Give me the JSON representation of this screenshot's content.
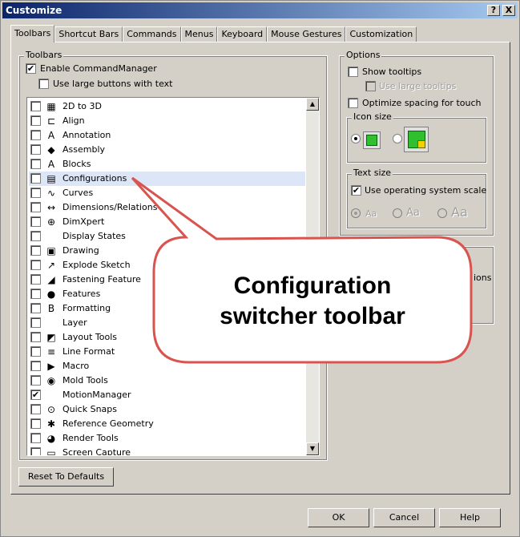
{
  "window": {
    "title": "Customize",
    "help_label": "?",
    "close_label": "X"
  },
  "tabs": [
    "Toolbars",
    "Shortcut Bars",
    "Commands",
    "Menus",
    "Keyboard",
    "Mouse Gestures",
    "Customization"
  ],
  "toolbars_group": {
    "label": "Toolbars",
    "enable_cm": {
      "label": "Enable CommandManager",
      "checked": true
    },
    "large_buttons": {
      "label": "Use large buttons with text",
      "checked": false
    }
  },
  "toolbar_list": [
    {
      "label": "2D to 3D",
      "checked": false,
      "icon": "2d-to-3d-icon"
    },
    {
      "label": "Align",
      "checked": false,
      "icon": "align-icon"
    },
    {
      "label": "Annotation",
      "checked": false,
      "icon": "annotation-icon"
    },
    {
      "label": "Assembly",
      "checked": false,
      "icon": "assembly-icon"
    },
    {
      "label": "Blocks",
      "checked": false,
      "icon": "blocks-icon"
    },
    {
      "label": "Configurations",
      "checked": false,
      "icon": "configurations-icon",
      "selected": true
    },
    {
      "label": "Curves",
      "checked": false,
      "icon": "curves-icon"
    },
    {
      "label": "Dimensions/Relations",
      "checked": false,
      "icon": "dimensions-icon"
    },
    {
      "label": "DimXpert",
      "checked": false,
      "icon": "dimxpert-icon"
    },
    {
      "label": "Display States",
      "checked": false,
      "icon": ""
    },
    {
      "label": "Drawing",
      "checked": false,
      "icon": "drawing-icon"
    },
    {
      "label": "Explode Sketch",
      "checked": false,
      "icon": "explode-sketch-icon"
    },
    {
      "label": "Fastening Feature",
      "checked": false,
      "icon": "fastening-feature-icon"
    },
    {
      "label": "Features",
      "checked": false,
      "icon": "features-icon"
    },
    {
      "label": "Formatting",
      "checked": false,
      "icon": "formatting-icon"
    },
    {
      "label": "Layer",
      "checked": false,
      "icon": ""
    },
    {
      "label": "Layout Tools",
      "checked": false,
      "icon": "layout-tools-icon"
    },
    {
      "label": "Line Format",
      "checked": false,
      "icon": "line-format-icon"
    },
    {
      "label": "Macro",
      "checked": false,
      "icon": "macro-icon"
    },
    {
      "label": "Mold Tools",
      "checked": false,
      "icon": "mold-tools-icon"
    },
    {
      "label": "MotionManager",
      "checked": true,
      "icon": ""
    },
    {
      "label": "Quick Snaps",
      "checked": false,
      "icon": "quick-snaps-icon"
    },
    {
      "label": "Reference Geometry",
      "checked": false,
      "icon": "reference-geometry-icon"
    },
    {
      "label": "Render Tools",
      "checked": false,
      "icon": "render-tools-icon"
    },
    {
      "label": "Screen Capture",
      "checked": false,
      "icon": "screen-capture-icon"
    }
  ],
  "options": {
    "label": "Options",
    "show_tooltips": "Show tooltips",
    "large_tooltips": "Use large tooltips",
    "optimize_touch": "Optimize spacing for touch",
    "icon_size": {
      "label": "Icon size",
      "selected": "small"
    },
    "text_size": {
      "label": "Text size",
      "use_os_scale": "Use operating system scale",
      "sizes": [
        "Aa",
        "Aa",
        "Aa"
      ]
    }
  },
  "partial_group_text": "ions",
  "buttons": {
    "reset": "Reset To Defaults",
    "ok": "OK",
    "cancel": "Cancel",
    "help": "Help"
  },
  "callout": {
    "line1": "Configuration",
    "line2": "switcher toolbar",
    "border_color": "#d9534f"
  }
}
